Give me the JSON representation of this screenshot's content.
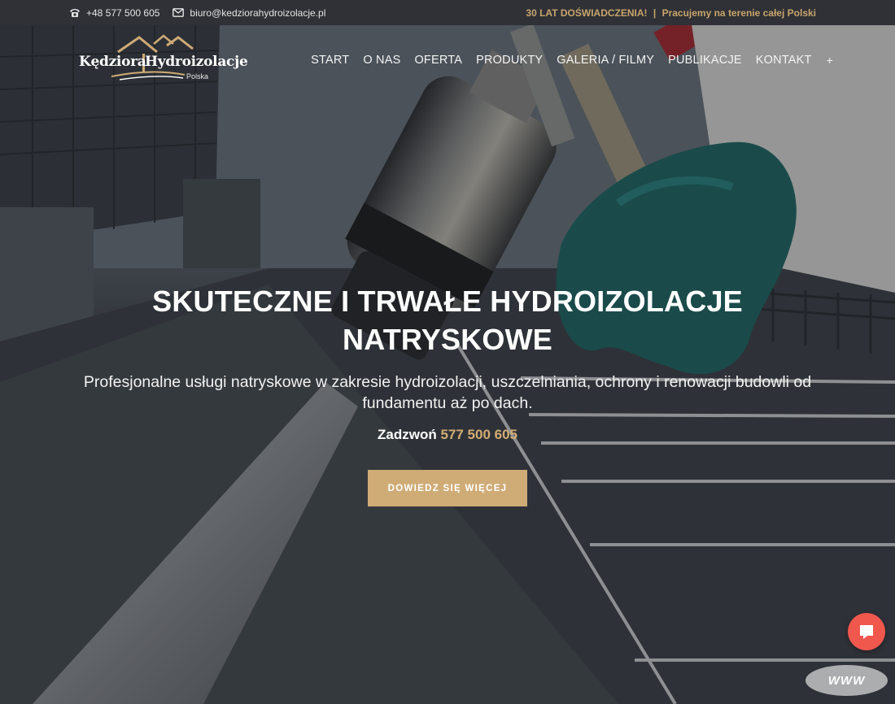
{
  "topbar": {
    "phone": "+48 577 500 605",
    "email": "biuro@kedziorahydroizolacje.pl",
    "tagline_strong": "30 LAT DOŚWIADCZENIA!",
    "tagline_sep": "|",
    "tagline_rest": "Pracujemy na terenie całej Polski"
  },
  "logo": {
    "left": "Kędziora",
    "right": "Hydroizolacje",
    "sub": "Polska"
  },
  "nav": {
    "items": [
      "START",
      "O NAS",
      "OFERTA",
      "PRODUKTY",
      "GALERIA / FILMY",
      "PUBLIKACJE",
      "KONTAKT"
    ],
    "more": "+"
  },
  "hero": {
    "title_line1": "SKUTECZNE I TRWAŁE HYDROIZOLACJE",
    "title_line2": "NATRYSKOWE",
    "subtitle": "Profesjonalne usługi natryskowe w zakresie hydroizolacji, uszczelniania, ochrony i renowacji budowli od fundamentu aż po dach.",
    "call_label": "Zadzwoń",
    "call_number": "577 500 605",
    "cta": "DOWIEDZ SIĘ WIĘCEJ"
  },
  "badge": {
    "text": "WWW"
  },
  "colors": {
    "accent": "#cfab76",
    "topbar": "#2f3136",
    "chat": "#f0584e"
  },
  "icons": {
    "phone": "phone-icon",
    "email": "envelope-icon",
    "chat": "chat-icon"
  }
}
